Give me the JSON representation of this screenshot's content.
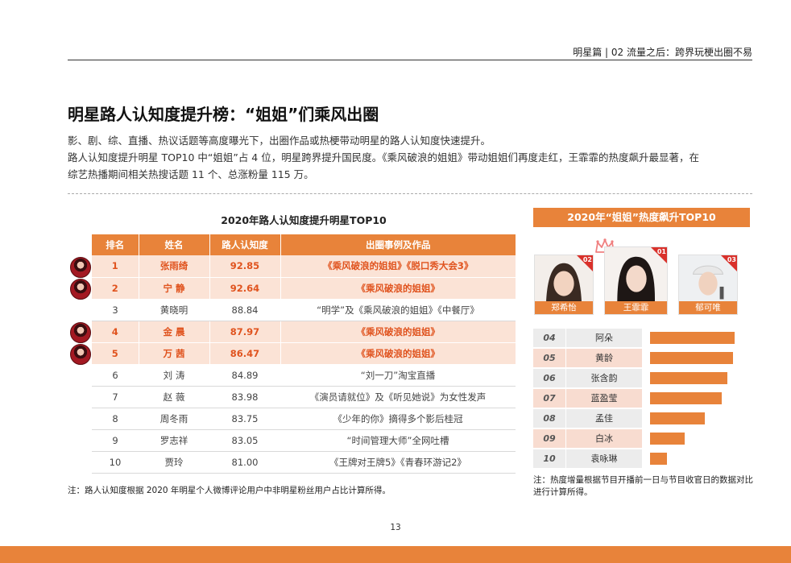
{
  "header": {
    "breadcrumb": "明星篇 | 02  流量之后：跨界玩梗出圈不易"
  },
  "title": "明星路人认知度提升榜：“姐姐”们乘风出圈",
  "intro": [
    "影、剧、综、直播、热议话题等高度曝光下，出圈作品或热梗带动明星的路人认知度快速提升。",
    "路人认知度提升明星 TOP10 中“姐姐”占 4 位，明星跨界提升国民度。《乘风破浪的姐姐》带动姐姐们再度走红，王霏霏的热度飙升最显著，在",
    "综艺热播期间相关热搜话题 11 个、总涨粉量 115 万。"
  ],
  "ranking_table": {
    "title": "2020年路人认知度提升明星TOP10",
    "headers": [
      "排名",
      "姓名",
      "路人认知度",
      "出圈事例及作品"
    ],
    "rows": [
      {
        "rank": "1",
        "name": "张雨绮",
        "score": "92.85",
        "works": "《乘风破浪的姐姐》《脱口秀大会3》",
        "highlight": true
      },
      {
        "rank": "2",
        "name": "宁 静",
        "score": "92.64",
        "works": "《乘风破浪的姐姐》",
        "highlight": true
      },
      {
        "rank": "3",
        "name": "黄晓明",
        "score": "88.84",
        "works": "“明学”及《乘风破浪的姐姐》《中餐厅》",
        "highlight": false
      },
      {
        "rank": "4",
        "name": "金 晨",
        "score": "87.97",
        "works": "《乘风破浪的姐姐》",
        "highlight": true
      },
      {
        "rank": "5",
        "name": "万 茜",
        "score": "86.47",
        "works": "《乘风破浪的姐姐》",
        "highlight": true
      },
      {
        "rank": "6",
        "name": "刘 涛",
        "score": "84.89",
        "works": "“刘一刀”淘宝直播",
        "highlight": false
      },
      {
        "rank": "7",
        "name": "赵 薇",
        "score": "83.98",
        "works": "《演员请就位》及《听见她说》为女性发声",
        "highlight": false
      },
      {
        "rank": "8",
        "name": "周冬雨",
        "score": "83.75",
        "works": "《少年的你》摘得多个影后桂冠",
        "highlight": false
      },
      {
        "rank": "9",
        "name": "罗志祥",
        "score": "83.05",
        "works": "“时间管理大师”全网吐槽",
        "highlight": false
      },
      {
        "rank": "10",
        "name": "贾玲",
        "score": "81.00",
        "works": "《王牌对王牌5》《青春环游记2》",
        "highlight": false
      }
    ],
    "note": "注：路人认知度根据 2020 年明星个人微博评论用户中非明星粉丝用户占比计算所得。"
  },
  "hot_rank": {
    "title": "2020年“姐姐”热度飙升TOP10",
    "top3": [
      {
        "badge": "02",
        "name": "郑希怡"
      },
      {
        "badge": "01",
        "name": "王霏霏"
      },
      {
        "badge": "03",
        "name": "郁可唯"
      }
    ],
    "list": [
      {
        "rank": "04",
        "name": "阿朵",
        "value": 1.0
      },
      {
        "rank": "05",
        "name": "黄龄",
        "value": 0.98
      },
      {
        "rank": "06",
        "name": "张含韵",
        "value": 0.91
      },
      {
        "rank": "07",
        "name": "蓝盈莹",
        "value": 0.85
      },
      {
        "rank": "08",
        "name": "孟佳",
        "value": 0.65
      },
      {
        "rank": "09",
        "name": "白冰",
        "value": 0.41
      },
      {
        "rank": "10",
        "name": "袁咏琳",
        "value": 0.2
      }
    ],
    "note": "注：热度增量根据节目开播前一日与节目收官日的数据对比进行计算所得。"
  },
  "page_number": "13",
  "colors": {
    "accent": "#e8833a",
    "highlight_text": "#e0531e",
    "highlight_bg": "#fbe3d6",
    "badge": "#d9312b"
  }
}
